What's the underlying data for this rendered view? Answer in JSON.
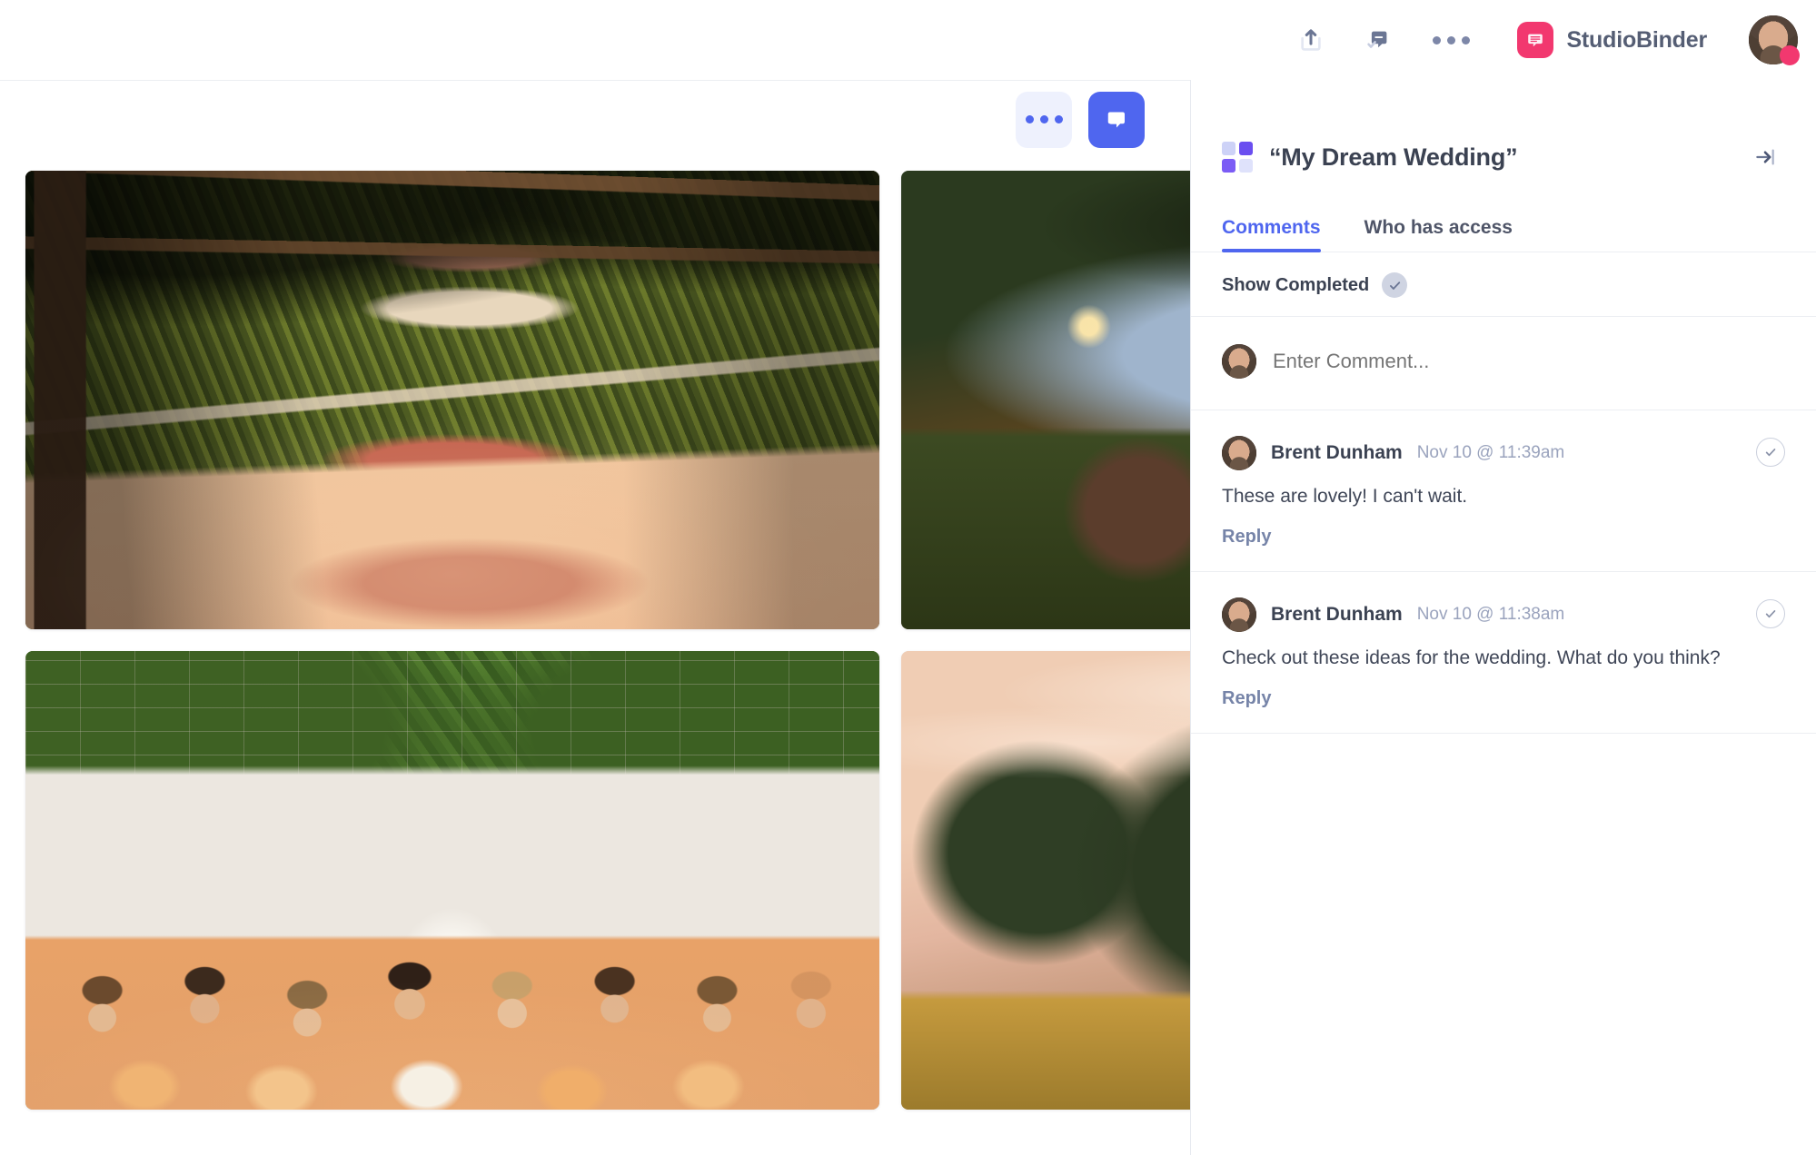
{
  "header": {
    "actions": [
      {
        "name": "share-icon",
        "label": "Share"
      },
      {
        "name": "comment-check-icon",
        "label": "Comments"
      },
      {
        "name": "more-options-icon",
        "label": "More"
      }
    ],
    "brand_name": "StudioBinder",
    "brand_logo_icon": "speech-bubble-icon",
    "avatar_status_color": "#f2386f"
  },
  "toolbar": {
    "more_button_icon": "more-dots-icon",
    "comment_button_icon": "comment-bubble-icon",
    "comment_button_active": true,
    "accent": "#4f66ef"
  },
  "gallery": {
    "items": [
      {
        "name": "photo-wedding-aisle-rugs",
        "alt": "Vintage Persian rugs laid out on grass forming a wedding ceremony aisle with wooden benches"
      },
      {
        "name": "photo-evening-reception",
        "alt": "Outdoor evening wedding reception with string lights and guests standing"
      },
      {
        "name": "photo-bridal-party",
        "alt": "Bridal party of eight women in peach and blush dresses holding bouquets in front of a white brick wall"
      },
      {
        "name": "photo-forest-sunset",
        "alt": "Pine trees on a hillside at golden hour with warm pink sky"
      }
    ]
  },
  "panel": {
    "title": "“My Dream Wedding”",
    "title_icon": "grid-squares-icon",
    "collapse_icon": "collapse-panel-icon",
    "tabs": [
      {
        "label": "Comments",
        "active": true
      },
      {
        "label": "Who has access",
        "active": false
      }
    ],
    "show_completed": {
      "label": "Show Completed",
      "checked": true,
      "icon": "check-circle-icon"
    },
    "composer": {
      "placeholder": "Enter Comment...",
      "avatar": "user-avatar"
    },
    "comments": [
      {
        "author": "Brent Dunham",
        "timestamp": "Nov 10 @ 11:39am",
        "body": "These are lovely! I can't wait.",
        "reply_label": "Reply",
        "resolve_icon": "check-circle-outline-icon"
      },
      {
        "author": "Brent Dunham",
        "timestamp": "Nov 10 @ 11:38am",
        "body": "Check out these ideas for the wedding. What do you think?",
        "reply_label": "Reply",
        "resolve_icon": "check-circle-outline-icon"
      }
    ]
  },
  "colors": {
    "accent_blue": "#4f66ef",
    "brand_pink": "#f2386f",
    "text_dark": "#3b4252",
    "text_muted": "#9aa3bd",
    "reply_blue": "#7684a8"
  }
}
